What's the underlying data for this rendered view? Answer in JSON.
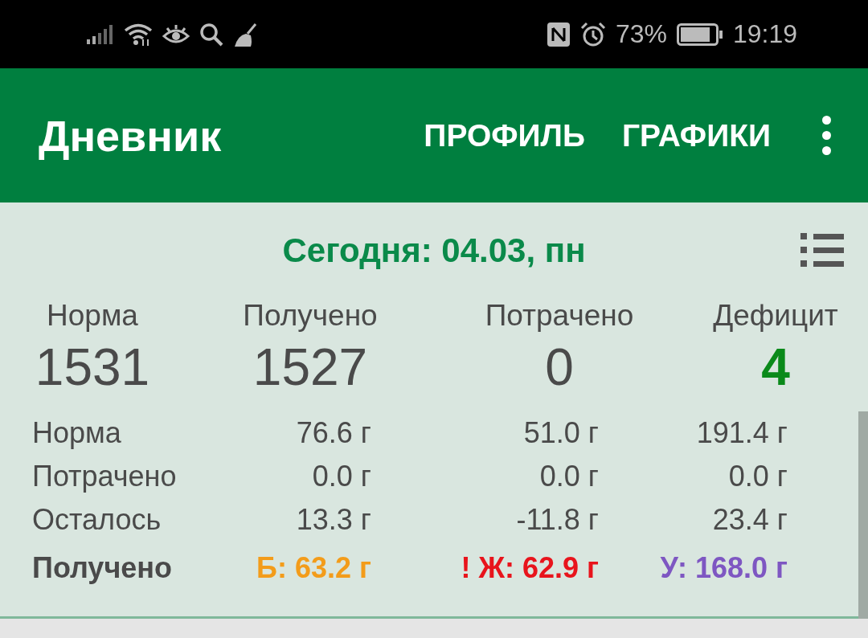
{
  "status_bar": {
    "battery_text": "73%",
    "time": "19:19"
  },
  "app_bar": {
    "title": "Дневник",
    "actions": [
      "ПРОФИЛЬ",
      "ГРАФИКИ"
    ]
  },
  "date_header": "Сегодня: 04.03, пн",
  "summary": [
    {
      "label": "Норма",
      "value": "1531",
      "color": "#4a4a4a"
    },
    {
      "label": "Получено",
      "value": "1527",
      "color": "#4a4a4a"
    },
    {
      "label": "Потрачено",
      "value": "0",
      "color": "#4a4a4a"
    },
    {
      "label": "Дефицит",
      "value": "4",
      "color": "#0a8a1a"
    }
  ],
  "macros": [
    {
      "label": "Норма",
      "values": [
        "76.6 г",
        "51.0 г",
        "191.4 г"
      ]
    },
    {
      "label": "Потрачено",
      "values": [
        "0.0 г",
        "0.0 г",
        "0.0 г"
      ]
    },
    {
      "label": "Осталось",
      "values": [
        "13.3 г",
        "-11.8 г",
        "23.4 г"
      ]
    }
  ],
  "totals": {
    "label": "Получено",
    "values": [
      {
        "text": "Б: 63.2 г",
        "color": "#f39c1a"
      },
      {
        "text": "! Ж: 62.9 г",
        "color": "#e8141c"
      },
      {
        "text": "У: 168.0 г",
        "color": "#7e57c2"
      }
    ]
  }
}
